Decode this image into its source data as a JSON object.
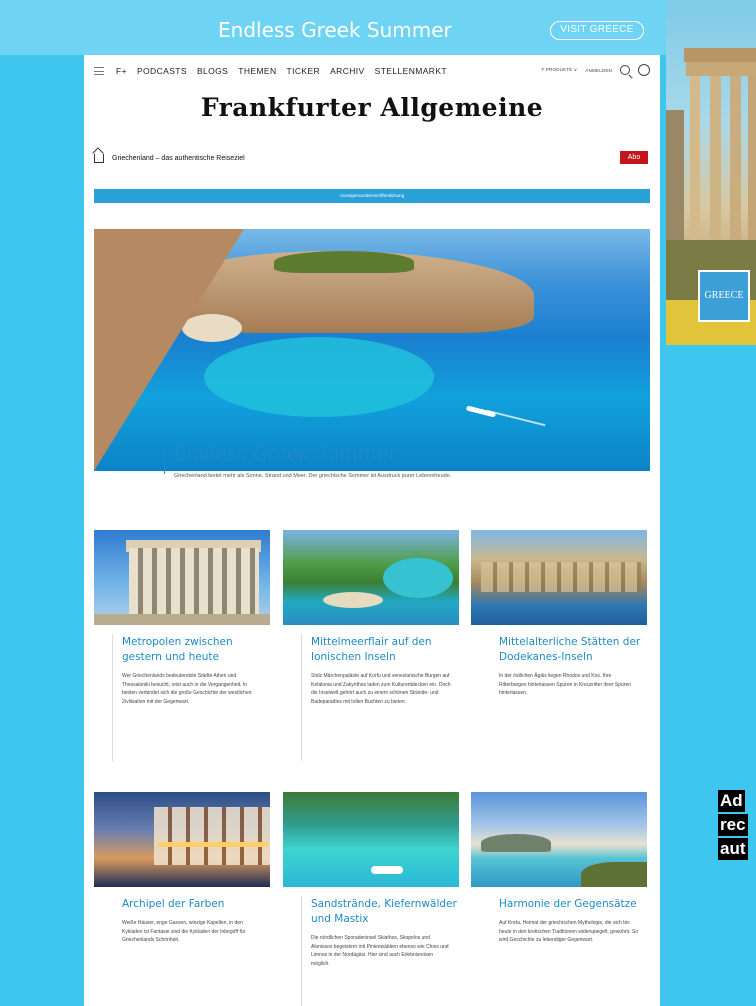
{
  "banner": {
    "title": "Endless Greek Summer",
    "button": "VISIT GREECE"
  },
  "right_ad": {
    "badge": "GREECE",
    "disclaimer_lines": [
      "Ad",
      "rec",
      "aut"
    ]
  },
  "nav": {
    "items": [
      "F+",
      "PODCASTS",
      "BLOGS",
      "THEMEN",
      "TICKER",
      "ARCHIV",
      "STELLENMARKT"
    ],
    "right_label_1": "F PRODUKTE ∨",
    "right_label_2": "ANMELDEN"
  },
  "masthead": "Frankfurter Allgemeine",
  "breadcrumb": "Griechenland – das authentische Reiseziel",
  "abo_button": "Abo",
  "ad_strip": "Anzeigensonderveröffentlichung",
  "hero": {
    "title": "Endless Greek Summer",
    "subtitle": "Griechenland bietet mehr als Sonne, Strand und Meer. Der griechische Sommer ist Ausdruck purer Lebensfreude."
  },
  "cards": [
    {
      "title": "Metropolen zwischen gestern und heute",
      "text": "Wer Griechenlands bedeutendste Städte Athen und Thessaloniki besucht, reist auch in die Vergangenheit. In beiden verbindet sich die große Geschichte der westlichen Zivilisation mit der Gegenwart."
    },
    {
      "title": "Mittelmeerflair auf den Ionischen Inseln",
      "text": "Stolz Märchenpaläste auf Korfu und venezianische Burgen auf Kefalonia und Zakynthos laden zum Kulturentdecken ein. Doch die Inselwelt gehört auch zu einem schönen Strände- und Badeparadies mit tollen Buchten zu bieten."
    },
    {
      "title": "Mittelalterliche Stätten der Dodekanes-Inseln",
      "text": "In der östlichen Ägäis liegen Rhodos und Kos. Ihre Ritterburgen hinterlassen Spuren in Kreuzritter ihrer Spuren hinterlassen."
    },
    {
      "title": "Archipel der Farben",
      "text": "Weiße Häuser, enge Gassen, winzige Kapellen, in den Kykladen ist Fantasie sind die Kykladen der Inbegriff für Griechenlands Schönheit."
    },
    {
      "title": "Sandstrände, Kiefernwälder und Mastix",
      "text": "Die nördlichen Sporadeninsel Skiathos, Skopelos und Alonissos begeistern mit Pinienwäldern ebenso wie Chios und Limnos in der Nordägäis. Hier sind auch Erlebnisreisen möglich."
    },
    {
      "title": "Harmonie der Gegensätze",
      "text": "Auf Kreta, Heimat der griechischen Mythologie, die sich bis heute in den kretischen Traditionen widerspiegelt, gewohnt. So wird Geschichte zu lebendiger Gegenwart."
    }
  ]
}
